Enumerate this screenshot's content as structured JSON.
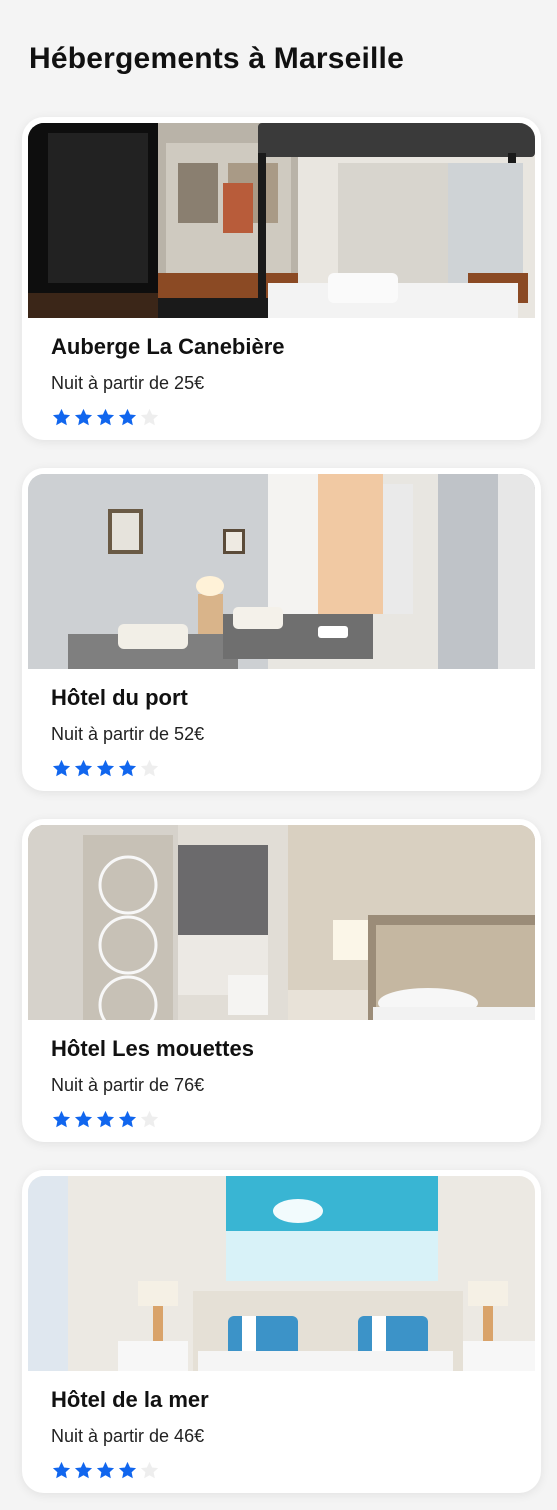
{
  "page": {
    "title": "Hébergements à Marseille"
  },
  "colors": {
    "star_filled": "#1166ee",
    "star_empty": "#eeeeee",
    "card_bg": "#ffffff",
    "page_bg": "#f4f4f4"
  },
  "listings": [
    {
      "name": "Auberge La Canebière",
      "price_label": "Nuit à partir de 25€",
      "rating": 4,
      "rating_max": 5,
      "image": "dormitory-bunk-beds-photo"
    },
    {
      "name": "Hôtel du port",
      "price_label": "Nuit à partir de 52€",
      "rating": 4,
      "rating_max": 5,
      "image": "twin-bedroom-photo"
    },
    {
      "name": "Hôtel Les mouettes",
      "price_label": "Nuit à partir de 76€",
      "rating": 4,
      "rating_max": 5,
      "image": "hotel-room-lamp-photo"
    },
    {
      "name": "Hôtel de la mer",
      "price_label": "Nuit à partir de 46€",
      "rating": 4,
      "rating_max": 5,
      "image": "seaside-bedroom-photo"
    }
  ]
}
